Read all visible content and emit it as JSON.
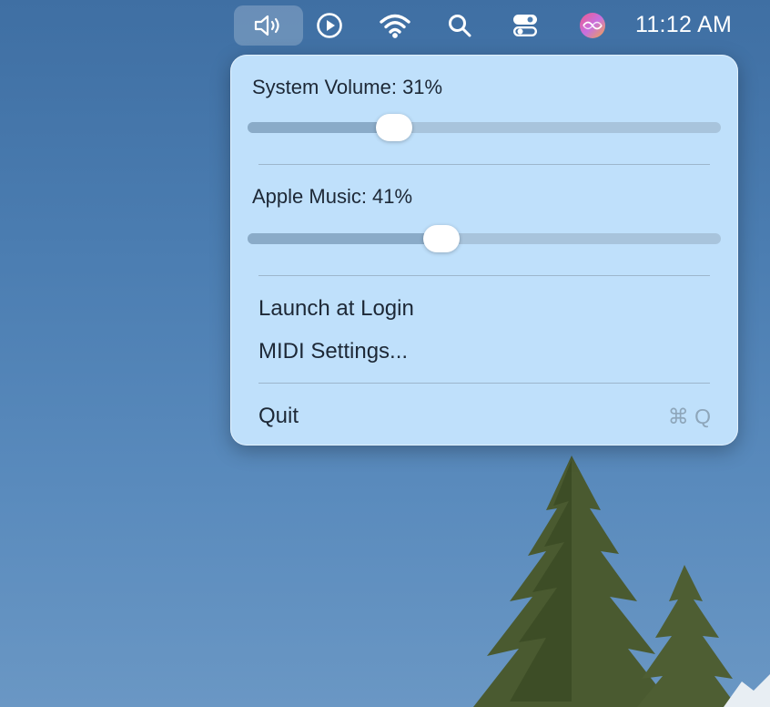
{
  "menubar": {
    "icons": [
      "speaker-volume-icon",
      "play-circle-icon",
      "wifi-icon",
      "search-icon",
      "control-center-icon",
      "siri-icon"
    ],
    "clock": "11:12 AM"
  },
  "panel": {
    "system_volume": {
      "label": "System Volume: 31%",
      "value": 31
    },
    "apple_music": {
      "label": "Apple Music: 41%",
      "value": 41
    },
    "items": [
      {
        "label": "Launch at Login"
      },
      {
        "label": "MIDI Settings..."
      }
    ],
    "quit": {
      "label": "Quit",
      "shortcut": "⌘ Q"
    }
  },
  "colors": {
    "panel_bg": "#bfe0fb",
    "track": "#a8c4dc",
    "track_fill": "#8aabc8",
    "sky": "#4b7db1"
  }
}
